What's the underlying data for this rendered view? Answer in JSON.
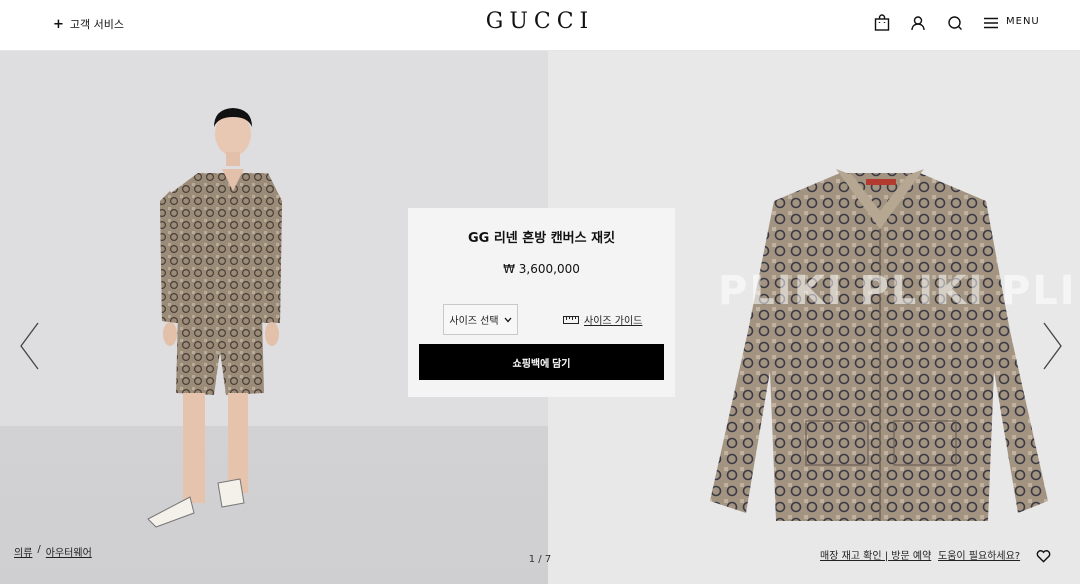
{
  "header": {
    "customer_service": "고객 서비스",
    "logo": "GUCCI",
    "menu_label": "MENU"
  },
  "product": {
    "title": "GG 리넨 혼방 캔버스 재킷",
    "price": "₩ 3,600,000",
    "size_select_label": "사이즈 선택",
    "size_guide_label": "사이즈 가이드",
    "add_to_bag_label": "쇼핑백에 담기"
  },
  "breadcrumb": {
    "category": "의류",
    "separator": "/",
    "subcategory": "아우터웨어"
  },
  "gallery": {
    "pager": "1 / 7"
  },
  "footer_links": {
    "store_check": "매장 재고 확인 | 방문 예약",
    "help": "도움이 필요하세요?"
  },
  "watermark_text": "PLIKI   PLIKI   PLIKI",
  "icons": {
    "header": [
      "shopping-bag-icon",
      "user-icon",
      "search-icon",
      "menu-icon"
    ],
    "nav": [
      "chevron-left-icon",
      "chevron-right-icon"
    ],
    "other": [
      "heart-icon",
      "ruler-icon",
      "chevron-down-icon"
    ]
  },
  "colors": {
    "accent": "#000000",
    "card_bg": "#f5f5f5",
    "left_bg": "#dedee0",
    "right_bg": "#e8e8e9"
  }
}
